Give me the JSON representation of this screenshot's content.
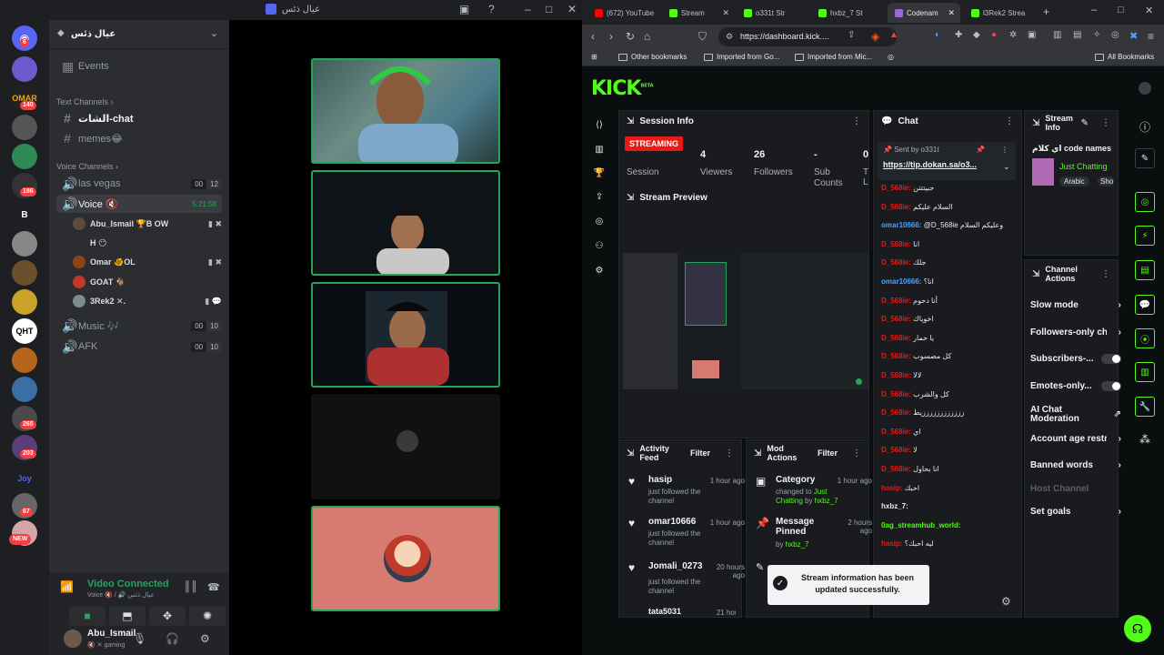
{
  "discord": {
    "window_title": "عيال ذئس",
    "server_name": "عيال ذئس",
    "events": "Events",
    "text_channels_header": "Text Channels",
    "text_channels": [
      "الشات-chat",
      "memes😂"
    ],
    "voice_channels_header": "Voice Channels",
    "voice_channels": [
      {
        "name": "las vegas",
        "count_a": "00",
        "count_b": "12"
      },
      {
        "name": "Voice 🔇",
        "timer": "5:21:58"
      },
      {
        "name": "Music 🎶",
        "count_a": "00",
        "count_b": "10"
      },
      {
        "name": "AFK",
        "count_a": "00",
        "count_b": "10"
      }
    ],
    "voice_users": [
      "Abu_Ismail 🏆B OW",
      "H 😶",
      "Omar 🐠OL",
      "GOAT 🐐",
      "3Rek2 ✕."
    ],
    "server_badges": [
      "6",
      "140",
      "186",
      "265",
      "203",
      "67",
      "NEW"
    ],
    "server_labels": [
      "OMAR",
      "B",
      "QHT",
      "Joy"
    ],
    "video_connected": "Video Connected",
    "voice_sub": "Voice 🔇 / 🔊 عيال ذئس",
    "username": "Abu_Ismail",
    "user_status": "🔇 ✕ gaming"
  },
  "browser": {
    "tabs": [
      "(672) YouTube",
      "Stream",
      "o331t Str",
      "hxbz_7 St",
      "Codenam",
      "l3Rek2 Strea"
    ],
    "url": "https://dashboard.kick....",
    "bookmarks": [
      "Other bookmarks",
      "Imported from Go...",
      "Imported from Mic...",
      "All Bookmarks"
    ]
  },
  "kick": {
    "logo": "KICK",
    "logo_sup": "BETA",
    "session_info": {
      "title": "Session Info",
      "badge": "STREAMING",
      "badge_label": "Session",
      "stats": [
        {
          "value": "4",
          "label": "Viewers"
        },
        {
          "value": "26",
          "label": "Followers"
        },
        {
          "value": "-",
          "label": "Sub Counts"
        },
        {
          "value": "0",
          "label": "T L"
        }
      ]
    },
    "stream_preview": "Stream Preview",
    "chat": {
      "title": "Chat",
      "pinned_by": "Sent by o331t",
      "pinned_link": "https://tip.dokan.sa/o3...",
      "messages": [
        {
          "user": "D_568ie:",
          "msg": "حبيتتتن",
          "color": "#e91916"
        },
        {
          "user": "D_568ie:",
          "msg": "السلام عليكم",
          "color": "#e91916"
        },
        {
          "user": "omar10666:",
          "msg": "@D_568ie وعليكم السلام",
          "color": "#4aa3ff"
        },
        {
          "user": "D_568ie:",
          "msg": "انا",
          "color": "#e91916"
        },
        {
          "user": "D_568ie:",
          "msg": "جلك",
          "color": "#e91916"
        },
        {
          "user": "omar10666:",
          "msg": "انا؟",
          "color": "#4aa3ff"
        },
        {
          "user": "D_568ie:",
          "msg": "أنا دحوم",
          "color": "#e91916"
        },
        {
          "user": "D_568ie:",
          "msg": "اخوياك",
          "color": "#e91916"
        },
        {
          "user": "D_568ie:",
          "msg": "يا حمار",
          "color": "#e91916"
        },
        {
          "user": "D_568ie:",
          "msg": "كل مصسوب",
          "color": "#e91916"
        },
        {
          "user": "D_568ie:",
          "msg": "لالا",
          "color": "#e91916"
        },
        {
          "user": "D_568ie:",
          "msg": "كل والشرب",
          "color": "#e91916"
        },
        {
          "user": "D_568ie:",
          "msg": "ززززززززززززيط",
          "color": "#e91916"
        },
        {
          "user": "D_568ie:",
          "msg": "اي",
          "color": "#e91916"
        },
        {
          "user": "D_568ie:",
          "msg": "لا",
          "color": "#e91916"
        },
        {
          "user": "D_568ie:",
          "msg": "انا بحاول",
          "color": "#e91916"
        },
        {
          "user": "hasip:",
          "msg": "احبك",
          "color": "#e91916"
        },
        {
          "user": "hxbz_7:",
          "msg": "",
          "color": "#e8eaed"
        },
        {
          "user": "0ag_streamhub_world:",
          "msg": "",
          "color": "#53fc18"
        },
        {
          "user": "hasip:",
          "msg": "ليه احبك؟",
          "color": "#e91916"
        }
      ]
    },
    "stream_info": {
      "title": "Stream Info",
      "stream_title": "اي كلام code names",
      "category": "Just Chatting",
      "tags": [
        "Arabic",
        "Sho"
      ]
    },
    "channel_actions": {
      "title": "Channel Actions",
      "items": [
        "Slow mode",
        "Followers-only ch",
        "Subscribers-...",
        "Emotes-only...",
        "AI Chat Moderation",
        "Account age restr",
        "Banned words",
        "Host Channel",
        "Set goals"
      ]
    },
    "activity_feed": {
      "title": "Activity Feed",
      "filter": "Filter",
      "items": [
        {
          "name": "hasip",
          "time": "1 hour ago",
          "desc": "just followed the channel"
        },
        {
          "name": "omar10666",
          "time": "1 hour ago",
          "desc": "just followed the channel"
        },
        {
          "name": "Jomali_0273",
          "time": "20 hours ago",
          "desc": "just followed the channel"
        },
        {
          "name": "tata5031",
          "time": "21 hours ago",
          "desc": ""
        }
      ]
    },
    "mod_actions": {
      "title": "Mod Actions",
      "filter": "Filter",
      "items": [
        {
          "name": "Category",
          "time": "1 hour ago",
          "desc_a": "changed to",
          "desc_b": "Just Chatting",
          "desc_c": "by",
          "desc_d": "hxbz_7"
        },
        {
          "name": "Message Pinned",
          "time": "2 hours ago",
          "desc_a": "by",
          "desc_b": "hxbz_7"
        }
      ]
    },
    "toast": "Stream information has been updated successfully."
  },
  "colors": {
    "kick_green": "#53fc18",
    "discord_green": "#23a55a",
    "streaming_red": "#e91916"
  }
}
